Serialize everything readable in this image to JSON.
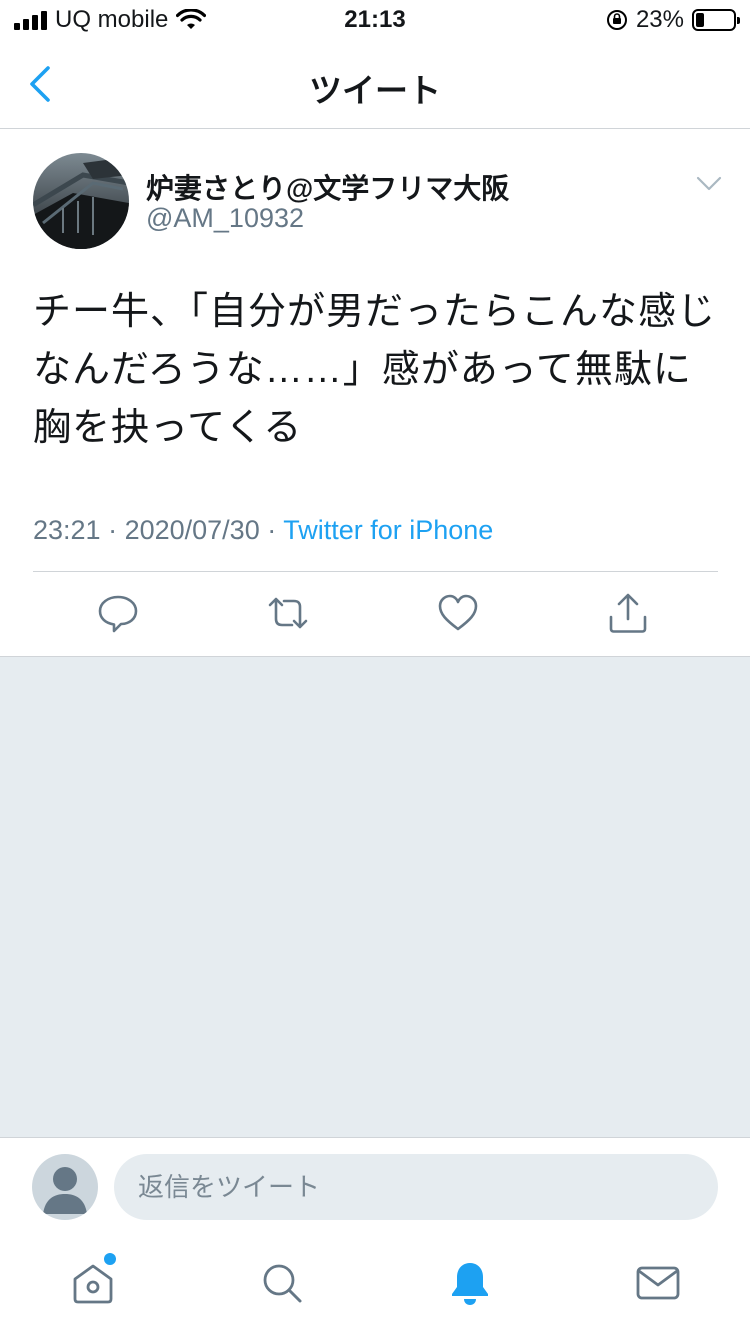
{
  "status_bar": {
    "carrier": "UQ mobile",
    "time": "21:13",
    "battery_percent": "23%",
    "battery_level": 0.23
  },
  "nav": {
    "title": "ツイート",
    "back_icon": "chevron-left-icon"
  },
  "tweet": {
    "author_name": "炉妻さとり@文学フリマ大阪",
    "author_handle": "@AM_10932",
    "text": "チー牛、「自分が男だったらこんな感じなんだろうな……」感があって無駄に胸を抉ってくる",
    "time": "23:21",
    "date": "2020/07/30",
    "separator": " · ",
    "source": "Twitter for iPhone",
    "actions": [
      "reply-icon",
      "retweet-icon",
      "like-icon",
      "share-icon"
    ]
  },
  "reply": {
    "placeholder": "返信をツイート"
  },
  "tabbar": {
    "items": [
      "home-icon",
      "search-icon",
      "notifications-icon",
      "messages-icon"
    ],
    "active": "notifications-icon",
    "accent": "#1da1f2"
  },
  "colors": {
    "accent": "#1da1f2",
    "secondary_text": "#657786",
    "background_gray": "#e6ecf0"
  }
}
